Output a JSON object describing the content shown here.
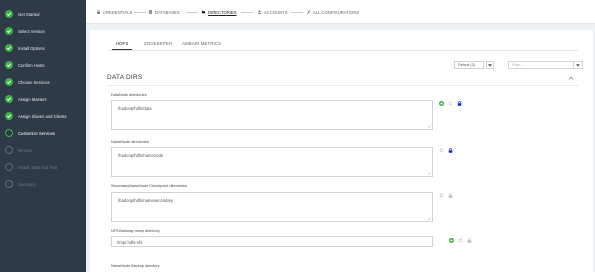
{
  "sidebar": {
    "steps": [
      {
        "label": "Get Started",
        "state": "done"
      },
      {
        "label": "Select Version",
        "state": "done"
      },
      {
        "label": "Install Options",
        "state": "done"
      },
      {
        "label": "Confirm Hosts",
        "state": "done"
      },
      {
        "label": "Choose Services",
        "state": "done"
      },
      {
        "label": "Assign Masters",
        "state": "done"
      },
      {
        "label": "Assign Slaves and Clients",
        "state": "done"
      },
      {
        "label": "Customize Services",
        "state": "current"
      },
      {
        "label": "Review",
        "state": "pending"
      },
      {
        "label": "Install, Start and Test",
        "state": "pending"
      },
      {
        "label": "Summary",
        "state": "pending"
      }
    ]
  },
  "topnav": {
    "items": [
      {
        "label": "CREDENTIALS",
        "icon": "lock-icon"
      },
      {
        "label": "DATABASES",
        "icon": "database-icon"
      },
      {
        "label": "DIRECTORIES",
        "icon": "folder-icon",
        "active": true
      },
      {
        "label": "ACCOUNTS",
        "icon": "user-icon"
      },
      {
        "label": "ALL CONFIGURATIONS",
        "icon": "wrench-icon"
      }
    ]
  },
  "tabs": [
    {
      "label": "HDFS",
      "active": true
    },
    {
      "label": "ZOOKEEPER"
    },
    {
      "label": "AMBARI METRICS"
    }
  ],
  "config_group": {
    "selected": "Default (3)"
  },
  "filter": {
    "placeholder": "Filter..."
  },
  "section": {
    "title": "DATA DIRS"
  },
  "fields": [
    {
      "label": "DataNode directories",
      "value": "/hadoop/hdfs/data"
    },
    {
      "label": "NameNode directories",
      "value": "/hadoop/hdfs/namenode"
    },
    {
      "label": "SecondaryNameNode Checkpoint directories",
      "value": "/hadoop/hdfs/namesecondary"
    },
    {
      "label": "NFSGateway dump directory",
      "value": "/tmp/.hdfs-nfs"
    },
    {
      "label": "NameNode Backup directory"
    }
  ],
  "colors": {
    "sidebar_bg": "#2e3a48",
    "success": "#3fae49",
    "lock": "#1a23c9",
    "muted_icon": "#bbbbbb"
  }
}
